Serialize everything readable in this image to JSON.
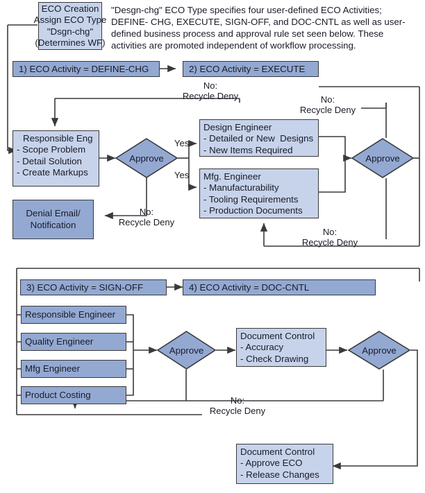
{
  "diagram": {
    "title": "ECO Workflow Diagram",
    "colors": {
      "fill_light": "#c6d3ea",
      "fill_mid": "#93a9d2",
      "stroke": "#3a3a3a",
      "text": "#1b1b28",
      "background": "#ffffff"
    },
    "intro_paragraph": [
      "\"Desgn-chg\" ECO Type specifies four user-defined ECO Activities; DEFINE-",
      "CHG, EXECUTE, SIGN-OFF, and  DOC-CNTL as well as user-defined",
      "business process and approval rule set seen below. These activities are",
      "promoted independent of workflow processing."
    ],
    "start_node": {
      "name": "eco-creation",
      "lines": [
        "ECO Creation",
        "Assign ECO Type",
        "\"Dsgn-chg\"",
        "(Determines WF)"
      ]
    },
    "activities": [
      {
        "name": "activity-define-chg",
        "label": "1) ECO Activity = DEFINE-CHG"
      },
      {
        "name": "activity-execute",
        "label": "2) ECO Activity = EXECUTE"
      },
      {
        "name": "activity-sign-off",
        "label": "3) ECO Activity = SIGN-OFF"
      },
      {
        "name": "activity-doc-cntl",
        "label": "4) ECO Activity = DOC-CNTL"
      }
    ],
    "process_nodes": [
      {
        "name": "responsible-eng",
        "lines": [
          "Responsible Eng",
          "- Scope Problem",
          "- Detail Solution",
          "- Create Markups"
        ]
      },
      {
        "name": "denial-email-notification",
        "lines": [
          "Denial Email/",
          "Notification"
        ]
      },
      {
        "name": "design-engineer",
        "lines": [
          "Design Engineer",
          "- Detailed or New  Designs",
          "- New Items Required"
        ]
      },
      {
        "name": "mfg-engineer",
        "lines": [
          "Mfg. Engineer",
          "- Manufacturability",
          "- Tooling Requirements",
          "- Production Documents"
        ]
      },
      {
        "name": "responsible-engineer",
        "lines": [
          "Responsible Engineer"
        ]
      },
      {
        "name": "quality-engineer",
        "lines": [
          "Quality Engineer"
        ]
      },
      {
        "name": "mfg-engineer-signoff",
        "lines": [
          "Mfg Engineer"
        ]
      },
      {
        "name": "product-costing",
        "lines": [
          "Product Costing"
        ]
      },
      {
        "name": "document-control-check",
        "lines": [
          "Document Control",
          "- Accuracy",
          "- Check Drawing"
        ]
      },
      {
        "name": "document-control-release",
        "lines": [
          "Document Control",
          "- Approve ECO",
          "- Release Changes"
        ]
      }
    ],
    "decisions": [
      {
        "name": "approve-define-chg",
        "label": "Approve"
      },
      {
        "name": "approve-execute",
        "label": "Approve"
      },
      {
        "name": "approve-sign-off",
        "label": "Approve"
      },
      {
        "name": "approve-doc-cntl",
        "label": "Approve"
      }
    ],
    "edge_labels": [
      {
        "name": "edge-label-yes-design",
        "text": "Yes"
      },
      {
        "name": "edge-label-yes-mfg",
        "text": "Yes"
      },
      {
        "name": "edge-label-no-top-left",
        "text": "No:\nRecycle Deny"
      },
      {
        "name": "edge-label-no-top-right",
        "text": "No:\nRecycle Deny"
      },
      {
        "name": "edge-label-no-denial",
        "text": "No:\nRecycle Deny"
      },
      {
        "name": "edge-label-no-mfg-recycle",
        "text": "No:\nRecycle Deny"
      },
      {
        "name": "edge-label-no-signoff",
        "text": "No:\nRecycle Deny"
      }
    ]
  }
}
